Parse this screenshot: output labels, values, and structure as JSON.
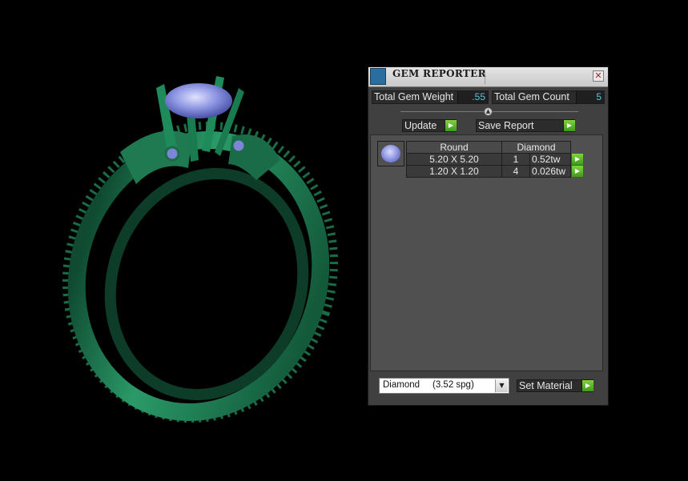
{
  "panel": {
    "title": "GEM REPORTER",
    "close_glyph": "✕",
    "total_gem_weight_label": "Total Gem Weight",
    "total_gem_weight_value": ".55",
    "total_gem_count_label": "Total Gem Count",
    "total_gem_count_value": "5",
    "slider_glyph": "▲",
    "update_label": "Update",
    "save_report_label": "Save Report",
    "arrow_glyph": "▶",
    "table": {
      "headers": [
        "Round",
        "Diamond"
      ],
      "rows": [
        {
          "size": "5.20 X 5.20",
          "count": "1",
          "weight": "0.52tw"
        },
        {
          "size": "1.20 X 1.20",
          "count": "4",
          "weight": "0.026tw"
        }
      ]
    },
    "material_select_value": "Diamond     (3.52 spg)",
    "caret_glyph": "▼",
    "set_material_label": "Set Material"
  },
  "colors": {
    "ring": "#1f7a52",
    "gem": "#8a93e0",
    "panel_bg": "#404040",
    "accent_arrow": "#5fbf2a",
    "value_text": "#58c6d8"
  }
}
